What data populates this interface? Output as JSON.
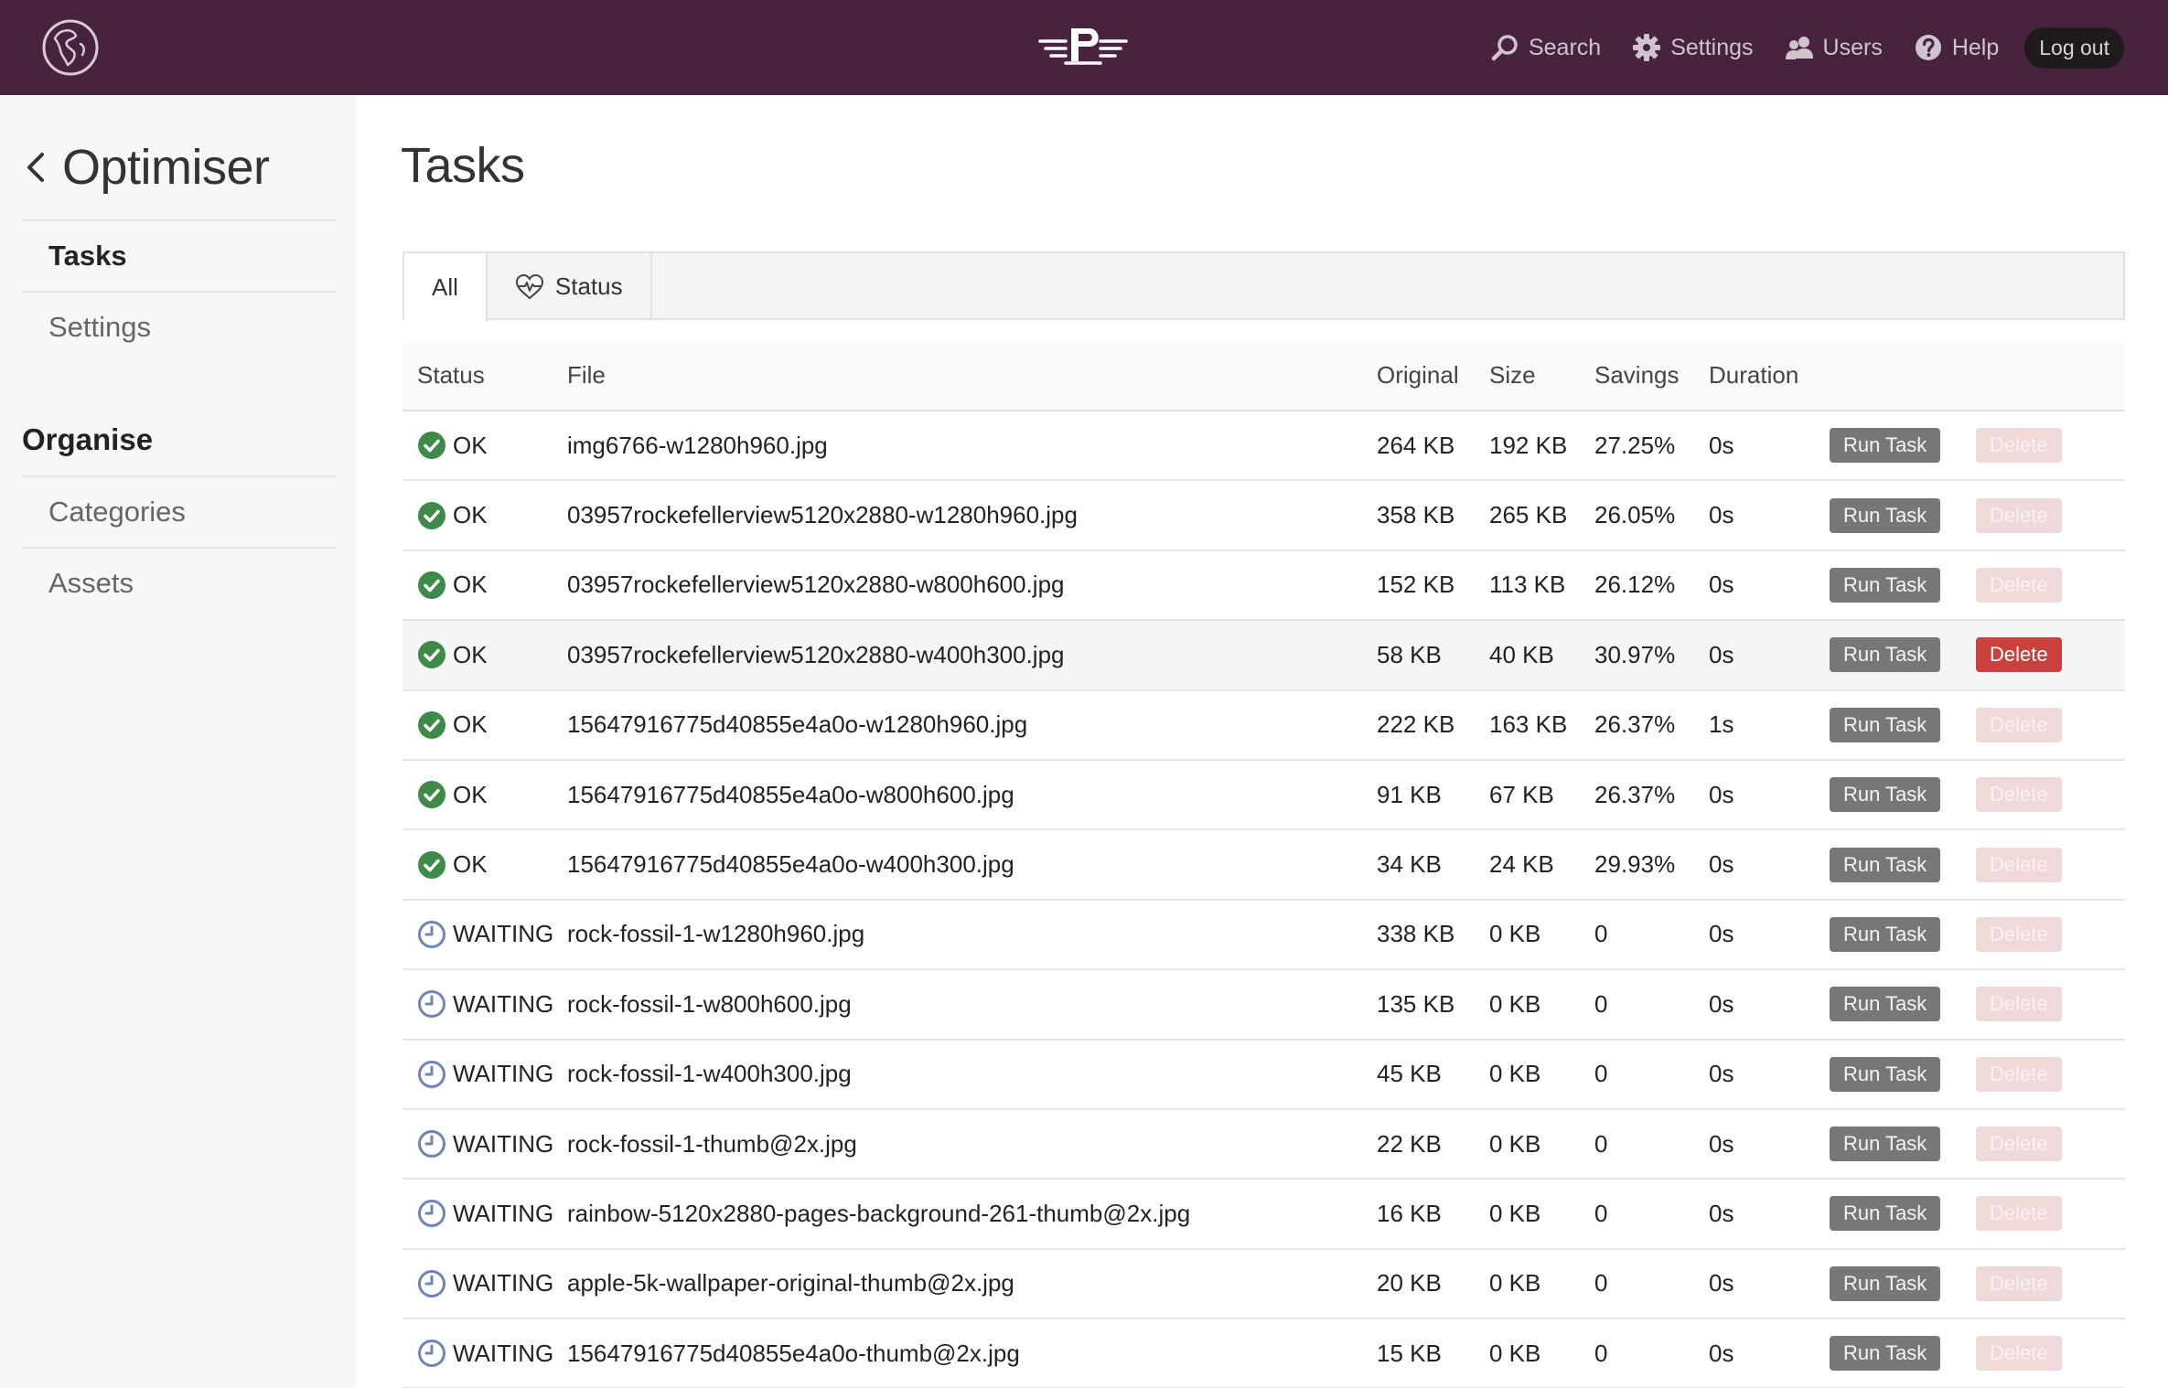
{
  "header": {
    "nav": [
      {
        "label": "Search",
        "icon": "search-icon"
      },
      {
        "label": "Settings",
        "icon": "gear-icon"
      },
      {
        "label": "Users",
        "icon": "users-icon"
      },
      {
        "label": "Help",
        "icon": "help-icon"
      }
    ],
    "logout_label": "Log out",
    "colors": {
      "bar": "#47233f"
    }
  },
  "sidebar": {
    "title": "Optimiser",
    "items": [
      {
        "label": "Tasks",
        "active": true
      },
      {
        "label": "Settings",
        "active": false
      }
    ],
    "section_heading": "Organise",
    "section_items": [
      {
        "label": "Categories"
      },
      {
        "label": "Assets"
      }
    ]
  },
  "main": {
    "title": "Tasks",
    "tabs": [
      {
        "label": "All",
        "active": true
      },
      {
        "label": "Status",
        "icon": "heartbeat-icon",
        "active": false
      }
    ],
    "columns": [
      "Status",
      "File",
      "Original",
      "Size",
      "Savings",
      "Duration"
    ],
    "run_label": "Run Task",
    "delete_label": "Delete",
    "rows": [
      {
        "status": "OK",
        "file": "img6766-w1280h960.jpg",
        "original": "264 KB",
        "size": "192 KB",
        "savings": "27.25%",
        "duration": "0s"
      },
      {
        "status": "OK",
        "file": "03957rockefellerview5120x2880-w1280h960.jpg",
        "original": "358 KB",
        "size": "265 KB",
        "savings": "26.05%",
        "duration": "0s"
      },
      {
        "status": "OK",
        "file": "03957rockefellerview5120x2880-w800h600.jpg",
        "original": "152 KB",
        "size": "113 KB",
        "savings": "26.12%",
        "duration": "0s"
      },
      {
        "status": "OK",
        "file": "03957rockefellerview5120x2880-w400h300.jpg",
        "original": "58 KB",
        "size": "40 KB",
        "savings": "30.97%",
        "duration": "0s",
        "hover": true
      },
      {
        "status": "OK",
        "file": "15647916775d40855e4a0o-w1280h960.jpg",
        "original": "222 KB",
        "size": "163 KB",
        "savings": "26.37%",
        "duration": "1s"
      },
      {
        "status": "OK",
        "file": "15647916775d40855e4a0o-w800h600.jpg",
        "original": "91 KB",
        "size": "67 KB",
        "savings": "26.37%",
        "duration": "0s"
      },
      {
        "status": "OK",
        "file": "15647916775d40855e4a0o-w400h300.jpg",
        "original": "34 KB",
        "size": "24 KB",
        "savings": "29.93%",
        "duration": "0s"
      },
      {
        "status": "WAITING",
        "file": "rock-fossil-1-w1280h960.jpg",
        "original": "338 KB",
        "size": "0 KB",
        "savings": "0",
        "duration": "0s"
      },
      {
        "status": "WAITING",
        "file": "rock-fossil-1-w800h600.jpg",
        "original": "135 KB",
        "size": "0 KB",
        "savings": "0",
        "duration": "0s"
      },
      {
        "status": "WAITING",
        "file": "rock-fossil-1-w400h300.jpg",
        "original": "45 KB",
        "size": "0 KB",
        "savings": "0",
        "duration": "0s"
      },
      {
        "status": "WAITING",
        "file": "rock-fossil-1-thumb@2x.jpg",
        "original": "22 KB",
        "size": "0 KB",
        "savings": "0",
        "duration": "0s"
      },
      {
        "status": "WAITING",
        "file": "rainbow-5120x2880-pages-background-261-thumb@2x.jpg",
        "original": "16 KB",
        "size": "0 KB",
        "savings": "0",
        "duration": "0s"
      },
      {
        "status": "WAITING",
        "file": "apple-5k-wallpaper-original-thumb@2x.jpg",
        "original": "20 KB",
        "size": "0 KB",
        "savings": "0",
        "duration": "0s"
      },
      {
        "status": "WAITING",
        "file": "15647916775d40855e4a0o-thumb@2x.jpg",
        "original": "15 KB",
        "size": "0 KB",
        "savings": "0",
        "duration": "0s"
      }
    ]
  }
}
